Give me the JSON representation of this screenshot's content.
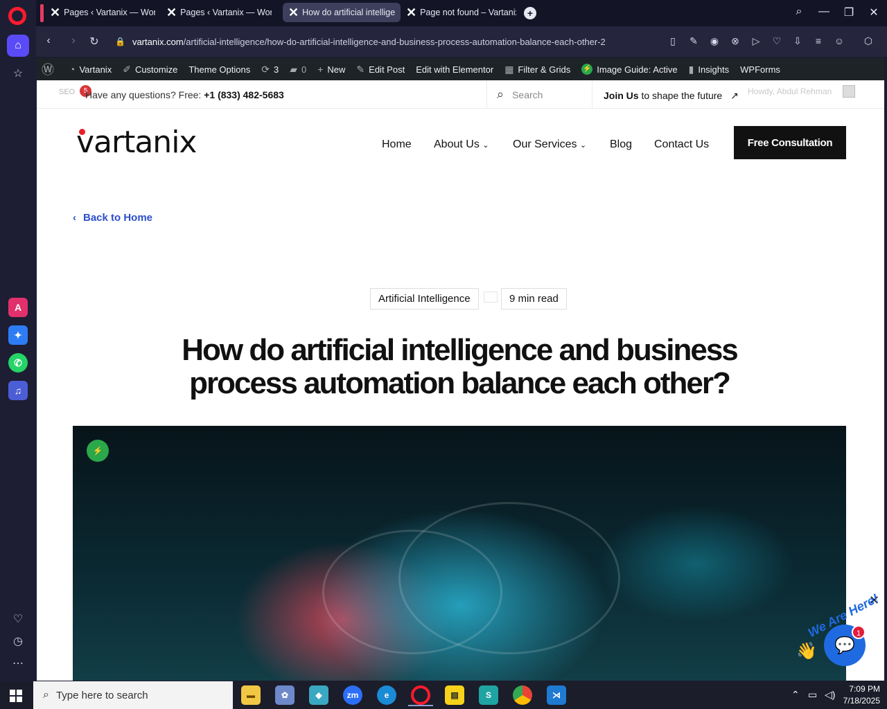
{
  "browser": {
    "tabs": [
      {
        "label": "Pages ‹ Vartanix — WordP",
        "active": false
      },
      {
        "label": "Pages ‹ Vartanix — WordP",
        "active": false
      },
      {
        "label": "How do artificial intelligen",
        "active": true
      },
      {
        "label": "Page not found – Vartanix",
        "active": false
      }
    ],
    "url_host": "vartanix.com",
    "url_path": "/artificial-intelligence/how-do-artificial-intelligence-and-business-process-automation-balance-each-other-2"
  },
  "wp_admin_bar": {
    "site_name": "Vartanix",
    "customize": "Customize",
    "theme_options": "Theme Options",
    "updates_count": "3",
    "comments_count": "0",
    "new": "New",
    "edit_post": "Edit Post",
    "edit_elementor": "Edit with Elementor",
    "filter_grids": "Filter & Grids",
    "image_guide": "Image Guide: Active",
    "insights": "Insights",
    "wpforms": "WPForms"
  },
  "topbar": {
    "seo": "SEO",
    "seo_count": "5",
    "question_prefix": "Have any questions? Free:",
    "phone": "+1 (833) 482-5683",
    "search_placeholder": "Search",
    "join_bold": "Join Us",
    "join_rest": "to shape the future",
    "howdy": "Howdy, Abdul Rehman"
  },
  "header": {
    "logo_text": "vartanix",
    "nav": [
      "Home",
      "About Us",
      "Our Services",
      "Blog",
      "Contact Us"
    ],
    "cta": "Free Consultation"
  },
  "article": {
    "back": "Back to Home",
    "category": "Artificial Intelligence",
    "read_time": "9 min read",
    "title": "How do artificial intelligence and business process automation balance each other?"
  },
  "chat": {
    "tagline": "We Are Here!",
    "unread": "1"
  },
  "taskbar": {
    "search_placeholder": "Type here to search",
    "time": "7:09 PM",
    "date": "7/18/2025"
  },
  "colors": {
    "accent": "#1f6ae0",
    "opera_red": "#ff1b2d",
    "link_blue": "#2b4ecb"
  }
}
